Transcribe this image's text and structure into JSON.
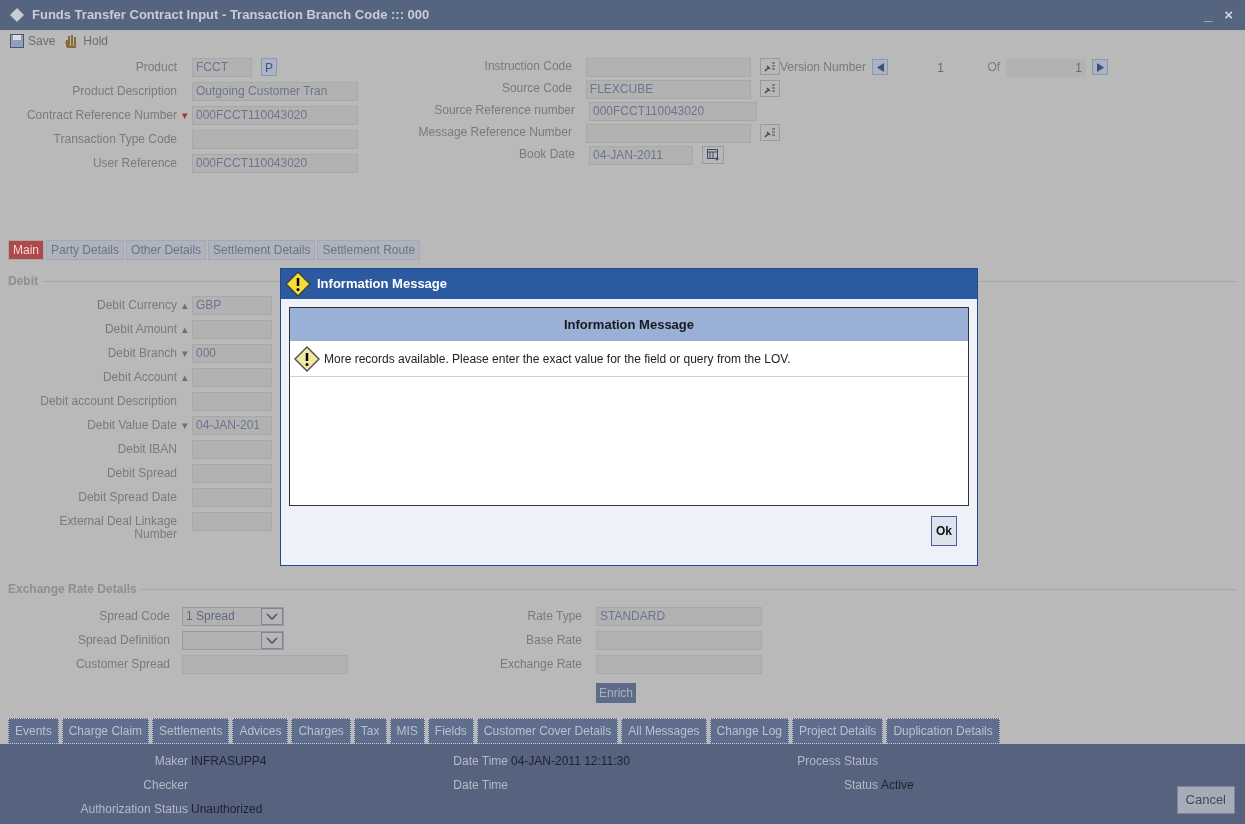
{
  "window": {
    "title": "Funds Transfer Contract Input - Transaction Branch Code ::: 000",
    "controls": [
      "_",
      "×"
    ]
  },
  "toolbar": [
    {
      "kind": "save",
      "label": "Save"
    },
    {
      "kind": "hold",
      "label": "Hold"
    }
  ],
  "header_left": [
    {
      "label": "Product",
      "value": "FCCT",
      "button": "P"
    },
    {
      "label": "Product Description",
      "value": "Outgoing Customer Tran"
    },
    {
      "label": "Contract Reference Number",
      "value": "000FCCT110043020",
      "marker": "▾"
    },
    {
      "label": "Transaction Type Code"
    },
    {
      "label": "User Reference",
      "value": "000FCCT110043020"
    }
  ],
  "header_middle": [
    {
      "label": "Instruction Code",
      "kind": "lov"
    },
    {
      "label": "Source Code",
      "value": "FLEXCUBE",
      "kind": "lov"
    },
    {
      "label": "Source Reference number",
      "value": "000FCCT110043020",
      "kind": "plain"
    },
    {
      "label": "Message Reference Number",
      "kind": "lov"
    },
    {
      "label": "Book Date",
      "value": "04-JAN-2011",
      "kind": "date"
    }
  ],
  "version": {
    "label": "Version Number",
    "current": "1",
    "of": "Of",
    "total": "1"
  },
  "tabs": [
    {
      "label": "Main",
      "selected": true
    },
    {
      "label": "Party Details",
      "selected": false
    },
    {
      "label": "Other Details",
      "selected": false
    },
    {
      "label": "Settlement Details",
      "selected": false
    },
    {
      "label": "Settlement Route",
      "selected": false
    }
  ],
  "debit": {
    "title": "Debit",
    "fields": [
      {
        "label": "Debit Currency",
        "value": "GBP",
        "marker": "▴"
      },
      {
        "label": "Debit Amount",
        "marker": "▴"
      },
      {
        "label": "Debit Branch",
        "value": "000",
        "marker": "▾"
      },
      {
        "label": "Debit Account",
        "marker": "▴"
      },
      {
        "label": "Debit account Description"
      },
      {
        "label": "Debit Value Date",
        "value": "04-JAN-201",
        "marker": "▾"
      },
      {
        "label": "Debit IBAN"
      },
      {
        "label": "Debit Spread"
      },
      {
        "label": "Debit Spread Date"
      },
      {
        "label": "External Deal Linkage Number"
      }
    ]
  },
  "exchange": {
    "title": "Exchange Rate Details",
    "left": [
      {
        "label": "Spread Code",
        "value": "1 Spread",
        "kind": "select"
      },
      {
        "label": "Spread Definition",
        "kind": "select"
      },
      {
        "label": "Customer Spread",
        "kind": "text"
      }
    ],
    "right": [
      {
        "label": "Rate Type",
        "value": "STANDARD"
      },
      {
        "label": "Base Rate"
      },
      {
        "label": "Exchange Rate"
      }
    ],
    "button": "Enrich"
  },
  "bottom_tabs": [
    "Events",
    "Charge Claim",
    "Settlements",
    "Advices",
    "Charges",
    "Tax",
    "MIS",
    "Fields",
    "Customer Cover Details",
    "All Messages",
    "Change Log",
    "Project Details",
    "Duplication Details"
  ],
  "footer": {
    "rows": [
      [
        {
          "label": "Maker",
          "value": "INFRASUPP4"
        },
        {
          "label": "Date Time",
          "value": "04-JAN-2011 12:11:30"
        },
        {
          "label": "Process Status"
        }
      ],
      [
        {
          "label": "Checker"
        },
        {
          "label": "Date Time"
        },
        {
          "label": "Status",
          "value": "Active"
        }
      ],
      [
        {
          "label": "Authorization Status",
          "value": "Unauthorized"
        }
      ]
    ],
    "cancel": "Cancel"
  },
  "dialog": {
    "title": "Information Message",
    "header": "Information Message",
    "message": "More records available. Please enter the exact value for the field or query from the LOV.",
    "ok": "Ok"
  }
}
